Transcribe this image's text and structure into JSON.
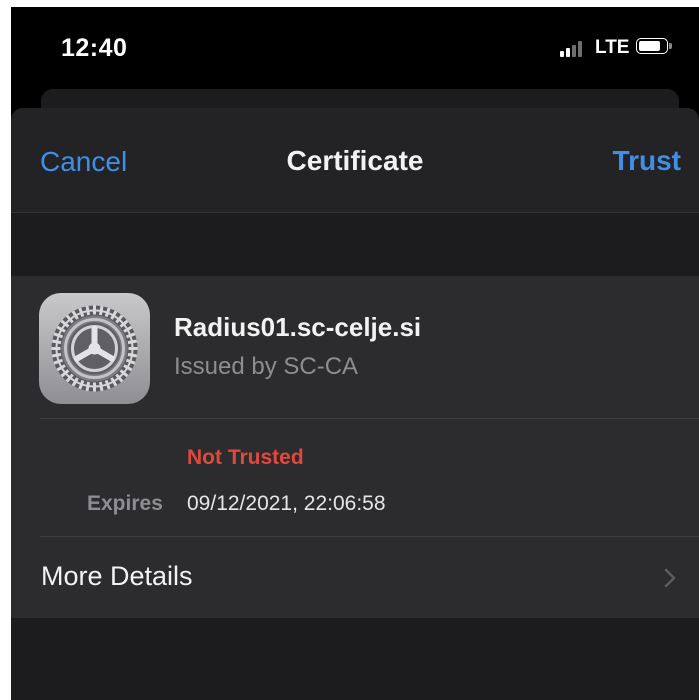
{
  "status_bar": {
    "time": "12:40",
    "network": "LTE",
    "signal_bars_active": 2,
    "signal_bars_total": 4
  },
  "nav": {
    "cancel_label": "Cancel",
    "title": "Certificate",
    "trust_label": "Trust"
  },
  "certificate": {
    "icon": "settings-gear-icon",
    "name": "Radius01.sc-celje.si",
    "issuer": "Issued by SC-CA",
    "status": "Not Trusted",
    "expires_label": "Expires",
    "expires_value": "09/12/2021, 22:06:58",
    "more_details_label": "More Details"
  },
  "colors": {
    "accent": "#3f8fe8",
    "danger": "#e1483d",
    "background": "#000000",
    "sheet": "#1c1c1e",
    "card": "#2c2c2e"
  }
}
